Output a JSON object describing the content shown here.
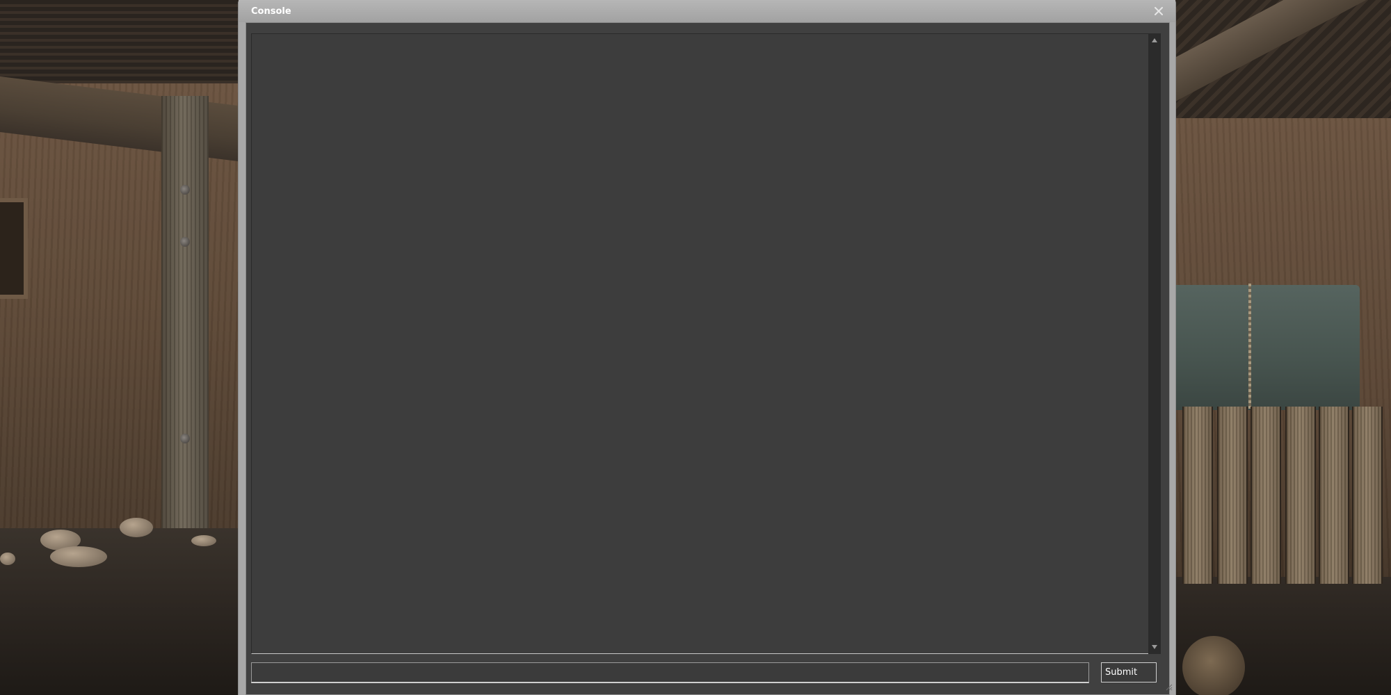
{
  "console": {
    "title": "Console",
    "close_icon": "close-icon",
    "output_text": "",
    "input": {
      "value": "",
      "placeholder": ""
    },
    "submit_label": "Submit"
  },
  "colors": {
    "window_frame": "#a8a8a8",
    "output_background": "#3d3d3d",
    "scrollbar_track": "#2b2b2b",
    "text": "#ffffff"
  }
}
